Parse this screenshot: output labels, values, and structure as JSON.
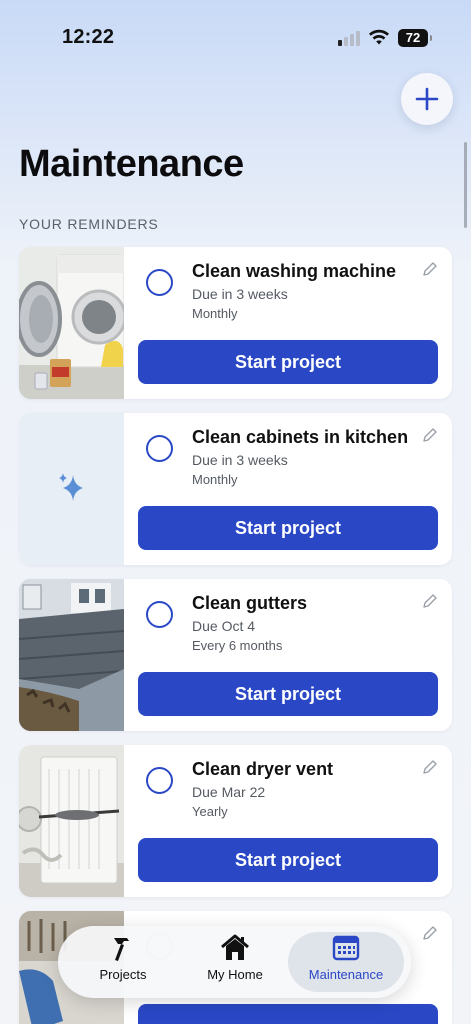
{
  "status_bar": {
    "time": "12:22",
    "battery": "72"
  },
  "header": {
    "title": "Maintenance",
    "section_label": "YOUR REMINDERS"
  },
  "reminders": [
    {
      "title": "Clean washing machine",
      "due": "Due in 3 weeks",
      "frequency": "Monthly",
      "button_label": "Start project",
      "image": "washing-machine-photo"
    },
    {
      "title": "Clean cabinets in kitchen",
      "due": "Due in 3 weeks",
      "frequency": "Monthly",
      "button_label": "Start project",
      "image": "sparkle-placeholder-icon"
    },
    {
      "title": "Clean gutters",
      "due": "Due Oct 4",
      "frequency": "Every 6 months",
      "button_label": "Start project",
      "image": "roof-gutter-photo"
    },
    {
      "title": "Clean dryer vent",
      "due": "Due Mar 22",
      "frequency": "Yearly",
      "button_label": "Start project",
      "image": "dryer-vent-photo"
    },
    {
      "title": "",
      "due": "",
      "frequency": "",
      "button_label": "",
      "image": "tools-photo"
    }
  ],
  "tabbar": {
    "items": [
      {
        "label": "Projects",
        "icon": "hammer-icon",
        "active": false
      },
      {
        "label": "My Home",
        "icon": "house-icon",
        "active": false
      },
      {
        "label": "Maintenance",
        "icon": "calendar-icon",
        "active": true
      }
    ]
  },
  "colors": {
    "accent": "#2a48c6",
    "card": "#ffffff",
    "background_top": "#c9daf7",
    "background": "#f2f4f8"
  }
}
